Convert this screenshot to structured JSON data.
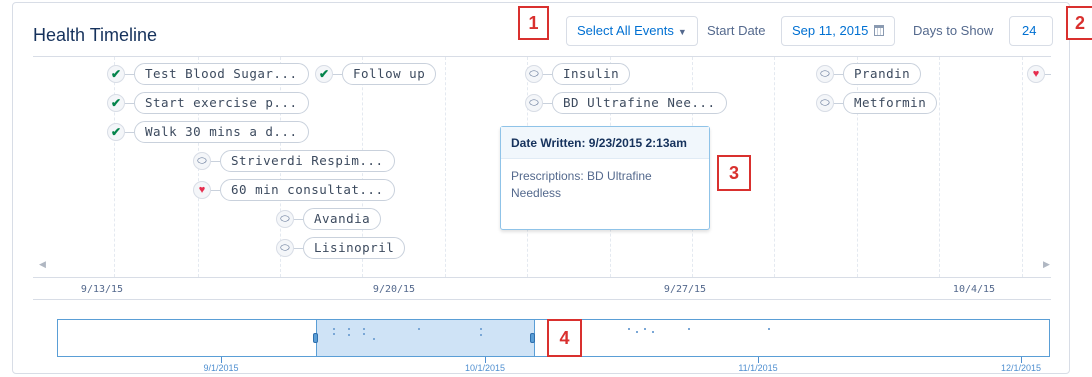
{
  "header": {
    "title": "Health Timeline",
    "select_events_label": "Select All Events",
    "start_date_label": "Start Date",
    "start_date_value": "Sep 11, 2015",
    "days_label": "Days to Show",
    "days_value": "24"
  },
  "events": [
    {
      "icon": "check",
      "label": "Test Blood Sugar..."
    },
    {
      "icon": "check",
      "label": "Follow up"
    },
    {
      "icon": "check",
      "label": "Start exercise p..."
    },
    {
      "icon": "check",
      "label": "Walk 30 mins a d..."
    },
    {
      "icon": "pill",
      "label": "Striverdi Respim..."
    },
    {
      "icon": "heart",
      "label": "60 min consultat..."
    },
    {
      "icon": "pill",
      "label": "Avandia"
    },
    {
      "icon": "pill",
      "label": "Lisinopril"
    },
    {
      "icon": "pill",
      "label": "Insulin"
    },
    {
      "icon": "pill",
      "label": "BD Ultrafine Nee..."
    },
    {
      "icon": "pill",
      "label": "Prandin"
    },
    {
      "icon": "pill",
      "label": "Metformin"
    },
    {
      "icon": "heart",
      "label": ""
    }
  ],
  "tooltip": {
    "heading": "Date Written: 9/23/2015 2:13am",
    "body": "Prescriptions: BD Ultrafine Needless"
  },
  "axis": {
    "labels": [
      "9/13/15",
      "9/20/15",
      "9/27/15",
      "10/4/15"
    ]
  },
  "navigator": {
    "labels": [
      "9/1/2015",
      "10/1/2015",
      "11/1/2015",
      "12/1/2015"
    ]
  },
  "callouts": [
    "1",
    "2",
    "3",
    "4"
  ],
  "colors": {
    "accent": "#0070d2",
    "check": "#04844b",
    "heart": "#e62d4e",
    "callout": "#d9302e",
    "selection": "#cfe3f6"
  }
}
